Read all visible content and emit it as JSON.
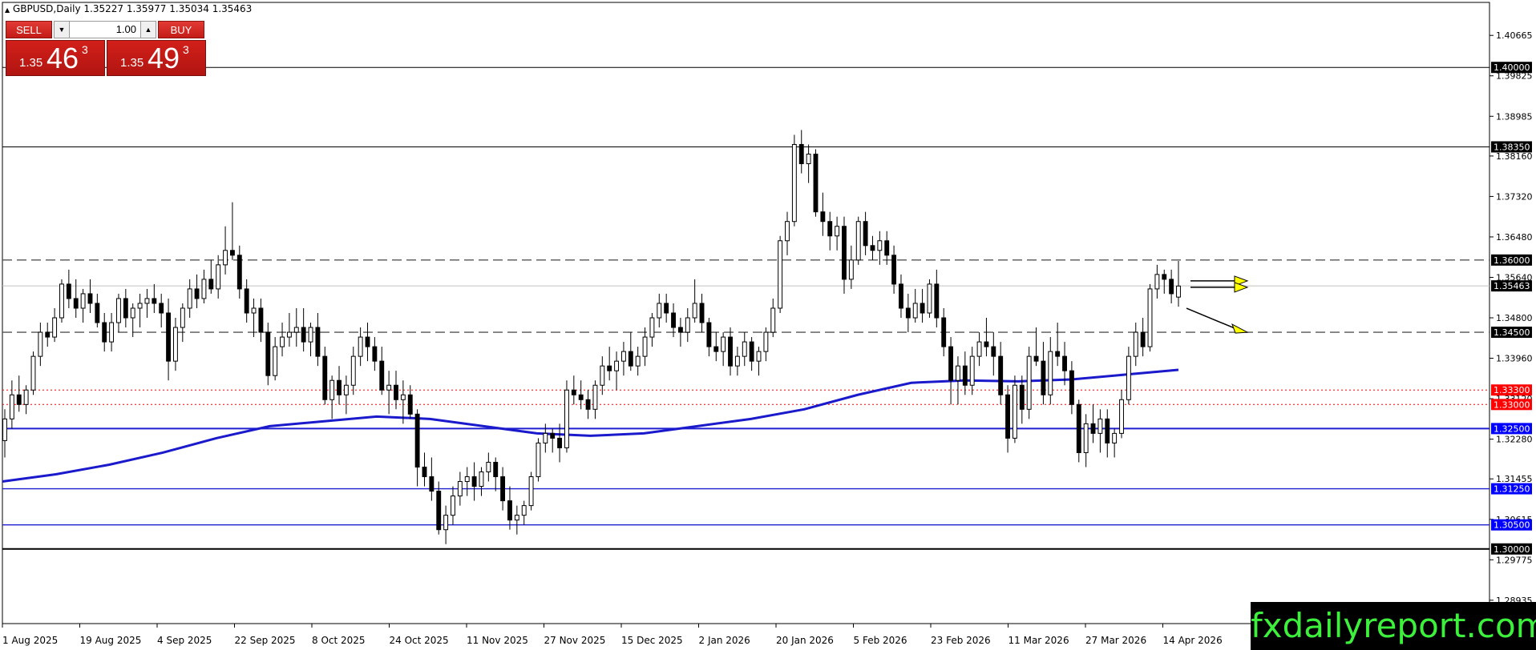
{
  "header": {
    "symbol_info": "GBPUSD,Daily  1.35227 1.35977 1.35034 1.35463"
  },
  "trade_panel": {
    "sell_label": "SELL",
    "buy_label": "BUY",
    "quantity": "1.00",
    "sell_price_prefix": "1.35",
    "sell_price_main": "46",
    "sell_price_sup": "3",
    "buy_price_prefix": "1.35",
    "buy_price_main": "49",
    "buy_price_sup": "3"
  },
  "watermark": "fxdailyreport.com",
  "colors": {
    "bull_candle": "#ffffff",
    "bear_candle": "#000000",
    "moving_average": "#1a1acc",
    "support_blue": "#1f1fd0",
    "red_dotted": "#ff0000",
    "label_black_bg": "#000000",
    "label_red_bg": "#ff0000",
    "label_blue_bg": "#0000ff",
    "arrow_fill": "#ffff00",
    "watermark_text": "#3cf03c"
  },
  "chart_data": {
    "type": "candlestick",
    "symbol": "GBPUSD",
    "timeframe": "Daily",
    "ylim": [
      1.2845,
      1.4135
    ],
    "y_ticks": [
      "1.40665",
      "1.39825",
      "1.38985",
      "1.38160",
      "1.37320",
      "1.36480",
      "1.35640",
      "1.34800",
      "1.33960",
      "1.33120",
      "1.32280",
      "1.31455",
      "1.30615",
      "1.29775",
      "1.28935"
    ],
    "x_labels": [
      "1 Aug 2025",
      "19 Aug 2025",
      "4 Sep 2025",
      "22 Sep 2025",
      "8 Oct 2025",
      "24 Oct 2025",
      "11 Nov 2025",
      "27 Nov 2025",
      "15 Dec 2025",
      "2 Jan 2026",
      "20 Jan 2026",
      "5 Feb 2026",
      "23 Feb 2026",
      "11 Mar 2026",
      "27 Mar 2026",
      "14 Apr 2026"
    ],
    "current_price": "1.35463",
    "levels": [
      {
        "price": "1.40000",
        "style": "solid",
        "label_bg": "black"
      },
      {
        "price": "1.38350",
        "style": "solid",
        "label_bg": "black"
      },
      {
        "price": "1.36000",
        "style": "dashed",
        "label_bg": "black"
      },
      {
        "price": "1.34500",
        "style": "dashed",
        "label_bg": "black"
      },
      {
        "price": "1.33300",
        "style": "dotted-red",
        "label_bg": "red"
      },
      {
        "price": "1.33000",
        "style": "dotted-red",
        "label_bg": "red"
      },
      {
        "price": "1.32500",
        "style": "solid-blue",
        "label_bg": "blue"
      },
      {
        "price": "1.31250",
        "style": "solid-blue",
        "label_bg": "blue"
      },
      {
        "price": "1.30500",
        "style": "solid-blue",
        "label_bg": "blue"
      },
      {
        "price": "1.30000",
        "style": "solid-black",
        "label_bg": "black"
      }
    ],
    "candles": [
      [
        1.3225,
        1.329,
        1.319,
        1.327
      ],
      [
        1.327,
        1.335,
        1.325,
        1.332
      ],
      [
        1.332,
        1.336,
        1.3285,
        1.33
      ],
      [
        1.33,
        1.334,
        1.328,
        1.333
      ],
      [
        1.333,
        1.341,
        1.332,
        1.34
      ],
      [
        1.34,
        1.347,
        1.338,
        1.345
      ],
      [
        1.345,
        1.347,
        1.342,
        1.344
      ],
      [
        1.344,
        1.35,
        1.343,
        1.348
      ],
      [
        1.348,
        1.356,
        1.347,
        1.355
      ],
      [
        1.355,
        1.358,
        1.35,
        1.352
      ],
      [
        1.352,
        1.356,
        1.348,
        1.35
      ],
      [
        1.35,
        1.354,
        1.347,
        1.353
      ],
      [
        1.353,
        1.356,
        1.349,
        1.351
      ],
      [
        1.351,
        1.353,
        1.346,
        1.347
      ],
      [
        1.347,
        1.349,
        1.341,
        1.343
      ],
      [
        1.343,
        1.349,
        1.341,
        1.347
      ],
      [
        1.347,
        1.353,
        1.345,
        1.352
      ],
      [
        1.352,
        1.354,
        1.346,
        1.348
      ],
      [
        1.348,
        1.351,
        1.344,
        1.35
      ],
      [
        1.35,
        1.353,
        1.346,
        1.351
      ],
      [
        1.351,
        1.354,
        1.348,
        1.352
      ],
      [
        1.352,
        1.355,
        1.349,
        1.351
      ],
      [
        1.351,
        1.353,
        1.346,
        1.349
      ],
      [
        1.349,
        1.352,
        1.335,
        1.339
      ],
      [
        1.339,
        1.348,
        1.337,
        1.346
      ],
      [
        1.346,
        1.351,
        1.343,
        1.35
      ],
      [
        1.35,
        1.356,
        1.348,
        1.354
      ],
      [
        1.354,
        1.357,
        1.35,
        1.352
      ],
      [
        1.352,
        1.358,
        1.351,
        1.356
      ],
      [
        1.356,
        1.36,
        1.353,
        1.354
      ],
      [
        1.354,
        1.361,
        1.352,
        1.359
      ],
      [
        1.359,
        1.367,
        1.357,
        1.362
      ],
      [
        1.362,
        1.372,
        1.36,
        1.361
      ],
      [
        1.361,
        1.363,
        1.352,
        1.354
      ],
      [
        1.354,
        1.356,
        1.347,
        1.349
      ],
      [
        1.349,
        1.352,
        1.344,
        1.35
      ],
      [
        1.35,
        1.352,
        1.343,
        1.345
      ],
      [
        1.345,
        1.347,
        1.334,
        1.336
      ],
      [
        1.336,
        1.344,
        1.335,
        1.342
      ],
      [
        1.342,
        1.347,
        1.34,
        1.344
      ],
      [
        1.344,
        1.349,
        1.342,
        1.345
      ],
      [
        1.345,
        1.35,
        1.342,
        1.346
      ],
      [
        1.346,
        1.35,
        1.341,
        1.343
      ],
      [
        1.343,
        1.347,
        1.34,
        1.346
      ],
      [
        1.346,
        1.349,
        1.338,
        1.34
      ],
      [
        1.34,
        1.342,
        1.33,
        1.331
      ],
      [
        1.331,
        1.336,
        1.327,
        1.335
      ],
      [
        1.335,
        1.338,
        1.33,
        1.332
      ],
      [
        1.332,
        1.336,
        1.328,
        1.334
      ],
      [
        1.334,
        1.342,
        1.332,
        1.34
      ],
      [
        1.34,
        1.346,
        1.338,
        1.344
      ],
      [
        1.344,
        1.347,
        1.339,
        1.342
      ],
      [
        1.342,
        1.344,
        1.337,
        1.339
      ],
      [
        1.339,
        1.342,
        1.332,
        1.333
      ],
      [
        1.333,
        1.337,
        1.328,
        1.334
      ],
      [
        1.334,
        1.337,
        1.329,
        1.331
      ],
      [
        1.331,
        1.335,
        1.326,
        1.332
      ],
      [
        1.332,
        1.334,
        1.327,
        1.328
      ],
      [
        1.328,
        1.329,
        1.313,
        1.317
      ],
      [
        1.317,
        1.32,
        1.313,
        1.315
      ],
      [
        1.315,
        1.319,
        1.31,
        1.312
      ],
      [
        1.312,
        1.314,
        1.303,
        1.304
      ],
      [
        1.304,
        1.309,
        1.301,
        1.307
      ],
      [
        1.307,
        1.313,
        1.305,
        1.311
      ],
      [
        1.311,
        1.316,
        1.309,
        1.314
      ],
      [
        1.314,
        1.317,
        1.311,
        1.315
      ],
      [
        1.315,
        1.318,
        1.31,
        1.313
      ],
      [
        1.313,
        1.317,
        1.311,
        1.316
      ],
      [
        1.316,
        1.32,
        1.314,
        1.318
      ],
      [
        1.318,
        1.319,
        1.312,
        1.315
      ],
      [
        1.315,
        1.317,
        1.308,
        1.31
      ],
      [
        1.31,
        1.313,
        1.304,
        1.306
      ],
      [
        1.306,
        1.309,
        1.303,
        1.307
      ],
      [
        1.307,
        1.31,
        1.305,
        1.309
      ],
      [
        1.309,
        1.316,
        1.308,
        1.315
      ],
      [
        1.315,
        1.323,
        1.314,
        1.322
      ],
      [
        1.322,
        1.326,
        1.32,
        1.324
      ],
      [
        1.324,
        1.325,
        1.32,
        1.323
      ],
      [
        1.323,
        1.326,
        1.318,
        1.321
      ],
      [
        1.321,
        1.335,
        1.32,
        1.333
      ],
      [
        1.333,
        1.336,
        1.33,
        1.332
      ],
      [
        1.332,
        1.335,
        1.329,
        1.331
      ],
      [
        1.331,
        1.333,
        1.327,
        1.329
      ],
      [
        1.329,
        1.335,
        1.327,
        1.334
      ],
      [
        1.334,
        1.34,
        1.332,
        1.338
      ],
      [
        1.338,
        1.342,
        1.335,
        1.337
      ],
      [
        1.337,
        1.341,
        1.333,
        1.339
      ],
      [
        1.339,
        1.343,
        1.336,
        1.341
      ],
      [
        1.341,
        1.345,
        1.337,
        1.338
      ],
      [
        1.338,
        1.342,
        1.336,
        1.34
      ],
      [
        1.34,
        1.346,
        1.338,
        1.344
      ],
      [
        1.344,
        1.349,
        1.342,
        1.348
      ],
      [
        1.348,
        1.353,
        1.346,
        1.351
      ],
      [
        1.351,
        1.353,
        1.347,
        1.349
      ],
      [
        1.349,
        1.351,
        1.344,
        1.346
      ],
      [
        1.346,
        1.348,
        1.342,
        1.345
      ],
      [
        1.345,
        1.35,
        1.343,
        1.348
      ],
      [
        1.348,
        1.356,
        1.347,
        1.351
      ],
      [
        1.351,
        1.353,
        1.345,
        1.347
      ],
      [
        1.347,
        1.348,
        1.34,
        1.342
      ],
      [
        1.342,
        1.345,
        1.339,
        1.341
      ],
      [
        1.341,
        1.345,
        1.338,
        1.344
      ],
      [
        1.344,
        1.346,
        1.336,
        1.338
      ],
      [
        1.338,
        1.342,
        1.336,
        1.34
      ],
      [
        1.34,
        1.345,
        1.338,
        1.343
      ],
      [
        1.343,
        1.344,
        1.337,
        1.339
      ],
      [
        1.339,
        1.342,
        1.336,
        1.341
      ],
      [
        1.341,
        1.346,
        1.339,
        1.345
      ],
      [
        1.345,
        1.352,
        1.344,
        1.35
      ],
      [
        1.35,
        1.365,
        1.349,
        1.364
      ],
      [
        1.364,
        1.37,
        1.361,
        1.368
      ],
      [
        1.368,
        1.386,
        1.367,
        1.384
      ],
      [
        1.384,
        1.387,
        1.378,
        1.38
      ],
      [
        1.38,
        1.384,
        1.376,
        1.382
      ],
      [
        1.382,
        1.383,
        1.369,
        1.37
      ],
      [
        1.37,
        1.374,
        1.365,
        1.368
      ],
      [
        1.368,
        1.37,
        1.362,
        1.365
      ],
      [
        1.365,
        1.369,
        1.362,
        1.367
      ],
      [
        1.367,
        1.369,
        1.353,
        1.356
      ],
      [
        1.356,
        1.363,
        1.354,
        1.36
      ],
      [
        1.36,
        1.369,
        1.359,
        1.368
      ],
      [
        1.368,
        1.37,
        1.361,
        1.363
      ],
      [
        1.363,
        1.365,
        1.36,
        1.362
      ],
      [
        1.362,
        1.366,
        1.359,
        1.364
      ],
      [
        1.364,
        1.366,
        1.359,
        1.361
      ],
      [
        1.361,
        1.363,
        1.353,
        1.355
      ],
      [
        1.355,
        1.357,
        1.348,
        1.35
      ],
      [
        1.35,
        1.353,
        1.345,
        1.348
      ],
      [
        1.348,
        1.354,
        1.347,
        1.351
      ],
      [
        1.351,
        1.354,
        1.347,
        1.349
      ],
      [
        1.349,
        1.356,
        1.348,
        1.355
      ],
      [
        1.355,
        1.358,
        1.346,
        1.348
      ],
      [
        1.348,
        1.35,
        1.34,
        1.342
      ],
      [
        1.342,
        1.344,
        1.33,
        1.335
      ],
      [
        1.335,
        1.34,
        1.33,
        1.338
      ],
      [
        1.338,
        1.341,
        1.332,
        1.334
      ],
      [
        1.334,
        1.342,
        1.332,
        1.34
      ],
      [
        1.34,
        1.345,
        1.338,
        1.343
      ],
      [
        1.343,
        1.348,
        1.34,
        1.342
      ],
      [
        1.342,
        1.345,
        1.336,
        1.34
      ],
      [
        1.34,
        1.343,
        1.33,
        1.332
      ],
      [
        1.332,
        1.334,
        1.32,
        1.323
      ],
      [
        1.323,
        1.336,
        1.322,
        1.334
      ],
      [
        1.334,
        1.336,
        1.326,
        1.329
      ],
      [
        1.329,
        1.342,
        1.327,
        1.34
      ],
      [
        1.34,
        1.346,
        1.338,
        1.339
      ],
      [
        1.339,
        1.343,
        1.33,
        1.332
      ],
      [
        1.332,
        1.344,
        1.33,
        1.341
      ],
      [
        1.341,
        1.347,
        1.338,
        1.34
      ],
      [
        1.34,
        1.343,
        1.334,
        1.337
      ],
      [
        1.337,
        1.339,
        1.328,
        1.33
      ],
      [
        1.33,
        1.331,
        1.318,
        1.32
      ],
      [
        1.32,
        1.328,
        1.317,
        1.326
      ],
      [
        1.326,
        1.33,
        1.322,
        1.324
      ],
      [
        1.324,
        1.329,
        1.32,
        1.327
      ],
      [
        1.327,
        1.329,
        1.319,
        1.322
      ],
      [
        1.322,
        1.325,
        1.319,
        1.324
      ],
      [
        1.324,
        1.333,
        1.323,
        1.331
      ],
      [
        1.331,
        1.342,
        1.33,
        1.34
      ],
      [
        1.34,
        1.347,
        1.338,
        1.345
      ],
      [
        1.345,
        1.348,
        1.34,
        1.342
      ],
      [
        1.342,
        1.355,
        1.341,
        1.354
      ],
      [
        1.354,
        1.359,
        1.352,
        1.357
      ],
      [
        1.357,
        1.358,
        1.353,
        1.356
      ],
      [
        1.356,
        1.358,
        1.351,
        1.353
      ],
      [
        1.3523,
        1.3598,
        1.3503,
        1.3546
      ]
    ],
    "moving_average": [
      1.314,
      1.3155,
      1.3175,
      1.32,
      1.323,
      1.3255,
      1.3265,
      1.3275,
      1.327,
      1.3255,
      1.324,
      1.3235,
      1.324,
      1.3255,
      1.327,
      1.329,
      1.332,
      1.3345,
      1.335,
      1.3348,
      1.3352,
      1.3362,
      1.3372
    ],
    "annotations": [
      {
        "type": "arrow",
        "direction": "right",
        "count": 2,
        "near_price": "1.3550"
      },
      {
        "type": "arrow",
        "direction": "down-right",
        "target_price": "1.3450"
      }
    ]
  }
}
